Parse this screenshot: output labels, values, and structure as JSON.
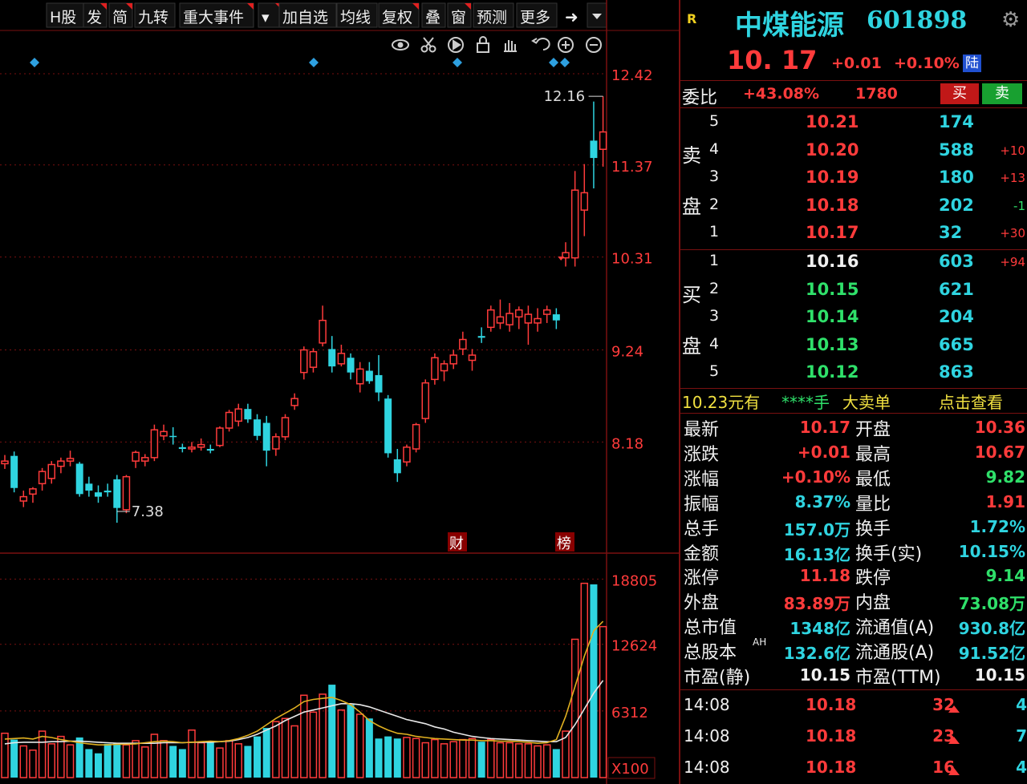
{
  "toolbar": {
    "items": [
      "H股",
      "发",
      "简",
      "九转",
      "重大事件",
      "▾",
      "加自选",
      "均线",
      "复权",
      "叠",
      "窗",
      "预测",
      "更多"
    ],
    "end_icon": "exit-icon",
    "icons": [
      "eye-icon",
      "scissors-icon",
      "play-icon",
      "lock-icon",
      "hand-icon",
      "undo-icon",
      "zoom-in-icon",
      "zoom-out-icon"
    ]
  },
  "price_axis": [
    "12.42",
    "11.37",
    "10.31",
    "9.24",
    "8.18"
  ],
  "volume_axis": [
    "18805",
    "12624",
    "6312",
    "X100"
  ],
  "annotations": {
    "high": "12.16",
    "low": "7.38",
    "marker_1": "财",
    "marker_2": "榜"
  },
  "chart_data": {
    "type": "candlestick",
    "ylim": [
      6.9,
      12.9
    ],
    "volume_ylim": [
      0,
      20500
    ],
    "candles": [
      [
        7.93,
        8.03,
        7.87,
        7.96
      ],
      [
        8.02,
        8.07,
        7.6,
        7.65
      ],
      [
        7.5,
        7.62,
        7.43,
        7.55
      ],
      [
        7.58,
        7.66,
        7.48,
        7.64
      ],
      [
        7.7,
        7.88,
        7.62,
        7.84
      ],
      [
        7.76,
        7.96,
        7.7,
        7.92
      ],
      [
        7.9,
        8.0,
        7.82,
        7.96
      ],
      [
        7.96,
        8.08,
        7.9,
        7.99
      ],
      [
        7.93,
        7.95,
        7.55,
        7.58
      ],
      [
        7.7,
        7.78,
        7.55,
        7.62
      ],
      [
        7.6,
        7.68,
        7.48,
        7.55
      ],
      [
        7.62,
        7.7,
        7.55,
        7.6
      ],
      [
        7.75,
        7.8,
        7.25,
        7.42
      ],
      [
        7.4,
        7.8,
        7.36,
        7.78
      ],
      [
        7.96,
        8.08,
        7.88,
        8.06
      ],
      [
        7.96,
        8.04,
        7.9,
        8.0
      ],
      [
        8.0,
        8.38,
        7.96,
        8.32
      ],
      [
        8.25,
        8.38,
        8.2,
        8.3
      ],
      [
        8.25,
        8.35,
        8.15,
        8.24
      ],
      [
        8.12,
        8.16,
        8.06,
        8.1
      ],
      [
        8.1,
        8.18,
        8.06,
        8.12
      ],
      [
        8.12,
        8.22,
        8.08,
        8.15
      ],
      [
        8.1,
        8.15,
        8.05,
        8.08
      ],
      [
        8.14,
        8.36,
        8.12,
        8.34
      ],
      [
        8.34,
        8.55,
        8.3,
        8.52
      ],
      [
        8.42,
        8.62,
        8.36,
        8.56
      ],
      [
        8.56,
        8.62,
        8.4,
        8.44
      ],
      [
        8.44,
        8.5,
        8.2,
        8.25
      ],
      [
        8.4,
        8.48,
        7.9,
        8.08
      ],
      [
        8.1,
        8.28,
        8.02,
        8.24
      ],
      [
        8.24,
        8.5,
        8.2,
        8.46
      ],
      [
        8.6,
        8.74,
        8.55,
        8.68
      ],
      [
        8.98,
        9.28,
        8.9,
        9.24
      ],
      [
        9.04,
        9.26,
        8.98,
        9.22
      ],
      [
        9.32,
        9.75,
        9.28,
        9.58
      ],
      [
        9.25,
        9.4,
        8.98,
        9.05
      ],
      [
        9.08,
        9.3,
        9.05,
        9.2
      ],
      [
        9.15,
        9.2,
        8.9,
        8.98
      ],
      [
        8.85,
        9.1,
        8.75,
        9.02
      ],
      [
        9.0,
        9.1,
        8.85,
        8.88
      ],
      [
        8.95,
        9.18,
        8.65,
        8.75
      ],
      [
        8.68,
        8.72,
        8.0,
        8.05
      ],
      [
        7.98,
        8.1,
        7.72,
        7.82
      ],
      [
        7.95,
        8.15,
        7.9,
        8.12
      ],
      [
        8.1,
        8.4,
        8.06,
        8.38
      ],
      [
        8.45,
        8.9,
        8.4,
        8.86
      ],
      [
        8.9,
        9.2,
        8.84,
        9.15
      ],
      [
        9.0,
        9.12,
        8.88,
        9.08
      ],
      [
        9.08,
        9.24,
        9.02,
        9.18
      ],
      [
        9.25,
        9.45,
        9.18,
        9.36
      ],
      [
        9.12,
        9.25,
        9.0,
        9.18
      ],
      [
        9.4,
        9.5,
        9.32,
        9.38
      ],
      [
        9.5,
        9.75,
        9.45,
        9.7
      ],
      [
        9.55,
        9.82,
        9.48,
        9.62
      ],
      [
        9.53,
        9.78,
        9.45,
        9.66
      ],
      [
        9.62,
        9.74,
        9.48,
        9.7
      ],
      [
        9.55,
        9.75,
        9.3,
        9.65
      ],
      [
        9.55,
        9.72,
        9.45,
        9.6
      ],
      [
        9.65,
        9.75,
        9.55,
        9.7
      ],
      [
        9.65,
        9.72,
        9.48,
        9.58
      ],
      [
        10.3,
        10.48,
        10.2,
        10.36
      ],
      [
        10.3,
        11.3,
        10.2,
        11.08
      ],
      [
        10.85,
        11.38,
        10.55,
        11.05
      ],
      [
        11.65,
        12.1,
        11.1,
        11.45
      ],
      [
        11.55,
        12.16,
        11.35,
        11.75
      ]
    ],
    "volumes": [
      4200,
      3600,
      3000,
      2600,
      4400,
      3200,
      3900,
      3100,
      3800,
      2700,
      2300,
      3200,
      3300,
      3100,
      3500,
      2900,
      4100,
      3500,
      3000,
      2700,
      4500,
      3300,
      3400,
      2800,
      3500,
      3200,
      3000,
      3900,
      4700,
      5300,
      5600,
      4900,
      7800,
      6200,
      7900,
      8800,
      6400,
      6900,
      6000,
      5600,
      3700,
      3900,
      3700,
      3800,
      3700,
      3300,
      3600,
      3200,
      3400,
      3600,
      3700,
      3400,
      3600,
      3300,
      3300,
      3200,
      3200,
      3000,
      3100,
      2700,
      4400,
      13100,
      18400,
      18300,
      14300
    ],
    "ma_short": [
      3650,
      3700,
      3750,
      3650,
      3900,
      3800,
      3600,
      3450,
      3300,
      3200,
      3100,
      3100,
      3150,
      3150,
      3200,
      3300,
      3400,
      3450,
      3400,
      3300,
      3350,
      3400,
      3450,
      3400,
      3500,
      3700,
      4000,
      4400,
      5000,
      5600,
      6100,
      6600,
      7200,
      7400,
      7500,
      7600,
      7300,
      6900,
      6200,
      5400,
      4900,
      4500,
      4200,
      4100,
      3900,
      3800,
      3700,
      3650,
      3600,
      3550,
      3550,
      3500,
      3500,
      3450,
      3450,
      3400,
      3350,
      3250,
      3300,
      3600,
      5800,
      8600,
      11500,
      13900,
      14800
    ],
    "ma_long": [
      3200,
      3300,
      3350,
      3350,
      3350,
      3400,
      3400,
      3450,
      3450,
      3400,
      3350,
      3300,
      3250,
      3250,
      3250,
      3250,
      3250,
      3300,
      3300,
      3300,
      3350,
      3350,
      3350,
      3400,
      3450,
      3600,
      3800,
      4100,
      4500,
      4900,
      5400,
      5800,
      6200,
      6400,
      6600,
      6800,
      7000,
      7000,
      6900,
      6700,
      6400,
      6100,
      5800,
      5500,
      5300,
      5100,
      4800,
      4600,
      4300,
      4100,
      3900,
      3800,
      3700,
      3650,
      3600,
      3550,
      3500,
      3450,
      3400,
      3400,
      3800,
      5000,
      6500,
      8000,
      9200
    ]
  },
  "quote": {
    "badge": "R",
    "name": "中煤能源",
    "code": "601898",
    "price": "10. 17",
    "change": "+0.01",
    "pct": "+0.10%",
    "tag": "陆",
    "ratio_label": "委比",
    "ratio": "+43.08%",
    "ratio_vol": "1780",
    "buy_btn": "买",
    "sell_btn": "卖"
  },
  "asks_label": [
    "卖",
    "盘"
  ],
  "bids_label": [
    "买",
    "盘"
  ],
  "asks": [
    {
      "n": "5",
      "p": "10.21",
      "v": "174",
      "d": ""
    },
    {
      "n": "4",
      "p": "10.20",
      "v": "588",
      "d": "+10"
    },
    {
      "n": "3",
      "p": "10.19",
      "v": "180",
      "d": "+13"
    },
    {
      "n": "2",
      "p": "10.18",
      "v": "202",
      "d": "-1"
    },
    {
      "n": "1",
      "p": "10.17",
      "v": "32",
      "d": "+30"
    }
  ],
  "bids": [
    {
      "n": "1",
      "p": "10.16",
      "v": "603",
      "d": "+94"
    },
    {
      "n": "2",
      "p": "10.15",
      "v": "621",
      "d": ""
    },
    {
      "n": "3",
      "p": "10.14",
      "v": "204",
      "d": ""
    },
    {
      "n": "4",
      "p": "10.13",
      "v": "665",
      "d": ""
    },
    {
      "n": "5",
      "p": "10.12",
      "v": "863",
      "d": ""
    }
  ],
  "big_order": {
    "price": "10.23元有",
    "stars": "****手",
    "label": "大卖单",
    "action": "点击查看"
  },
  "stats": [
    {
      "l1": "最新",
      "v1": "10.17",
      "l2": "开盘",
      "v2": "10.36"
    },
    {
      "l1": "涨跌",
      "v1": "+0.01",
      "l2": "最高",
      "v2": "10.67"
    },
    {
      "l1": "涨幅",
      "v1": "+0.10%",
      "l2": "最低",
      "v2": "9.82"
    },
    {
      "l1": "振幅",
      "v1": "8.37%",
      "l2": "量比",
      "v2": "1.91"
    },
    {
      "l1": "总手",
      "v1": "157.0万",
      "l2": "换手",
      "v2": "1.72%"
    },
    {
      "l1": "金额",
      "v1": "16.13亿",
      "l2": "换手(实)",
      "v2": "10.15%"
    },
    {
      "l1": "涨停",
      "v1": "11.18",
      "l2": "跌停",
      "v2": "9.14"
    },
    {
      "l1": "外盘",
      "v1": "83.89万",
      "l2": "内盘",
      "v2": "73.08万"
    },
    {
      "l1": "总市值",
      "v1": "1348亿",
      "l2": "流通值(A)",
      "v2": "930.8亿"
    },
    {
      "l1": "总股本",
      "sup": "AH",
      "v1": "132.6亿",
      "l2": "流通股(A)",
      "v2": "91.52亿"
    },
    {
      "l1": "市盈(静)",
      "v1": "10.15",
      "l2": "市盈(TTM)",
      "v2": "10.15"
    }
  ],
  "stat_colors": [
    [
      "red",
      "red"
    ],
    [
      "red",
      "red"
    ],
    [
      "red",
      "green"
    ],
    [
      "cyan",
      "red"
    ],
    [
      "cyan",
      "cyan"
    ],
    [
      "cyan",
      "cyan"
    ],
    [
      "red",
      "green"
    ],
    [
      "red",
      "green"
    ],
    [
      "cyan",
      "cyan"
    ],
    [
      "cyan",
      "cyan"
    ],
    [
      "white",
      "white"
    ]
  ],
  "ticks": [
    {
      "time": "14:08",
      "price": "10.18",
      "vol": "32",
      "n": "4"
    },
    {
      "time": "14:08",
      "price": "10.18",
      "vol": "23",
      "n": "7"
    },
    {
      "time": "14:08",
      "price": "10.18",
      "vol": "16",
      "n": "4"
    }
  ],
  "colors": {
    "up": "#ff3b3b",
    "down": "#2fd4e0",
    "grid": "#7a1010",
    "ma_short": "#e0b020",
    "ma_long": "#e8e8e8"
  }
}
